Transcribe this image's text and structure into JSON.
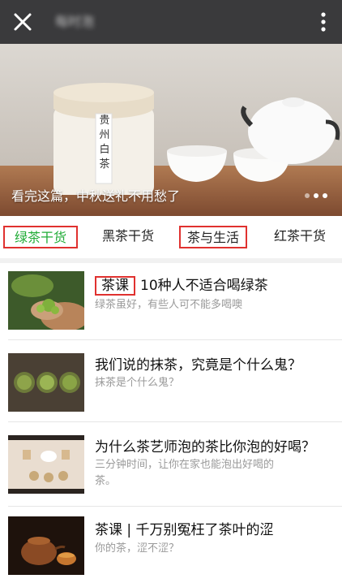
{
  "header": {
    "close_icon": "close-icon",
    "title": "每时泡",
    "more_icon": "more-vertical-icon"
  },
  "banner": {
    "caption": "看完这篇，中秋送礼不用愁了",
    "jar_text": "贵 州 白 茶",
    "slides": 3,
    "active_slide": 2
  },
  "tabs": [
    {
      "label": "绿茶干货",
      "active": true,
      "boxed": true
    },
    {
      "label": "黑茶干货",
      "active": false,
      "boxed": false
    },
    {
      "label": "茶与生活",
      "active": false,
      "boxed": true
    },
    {
      "label": "红茶干货",
      "active": false,
      "boxed": false
    }
  ],
  "articles": [
    {
      "tag": "茶课",
      "title": "10种人不适合喝绿茶",
      "subtitle": "绿茶虽好，有些人可不能多喝噢"
    },
    {
      "tag": "",
      "title": "我们说的抹茶，究竟是个什么鬼？",
      "subtitle": "抹茶是个什么鬼？"
    },
    {
      "tag": "",
      "title": "为什么茶艺师泡的茶比你泡的好喝？",
      "subtitle_line1": "三分钟时间，让你在家也能泡出好喝的",
      "subtitle_line2": "茶。"
    },
    {
      "tag": "",
      "title": "茶课 | 千万别冤枉了茶叶的涩",
      "subtitle": "你的茶，涩不涩？"
    }
  ],
  "colors": {
    "topbar": "#3a3a3c",
    "active_tab": "#22ac38",
    "highlight_box": "#e0312f",
    "subtitle": "#9a9a9a"
  }
}
